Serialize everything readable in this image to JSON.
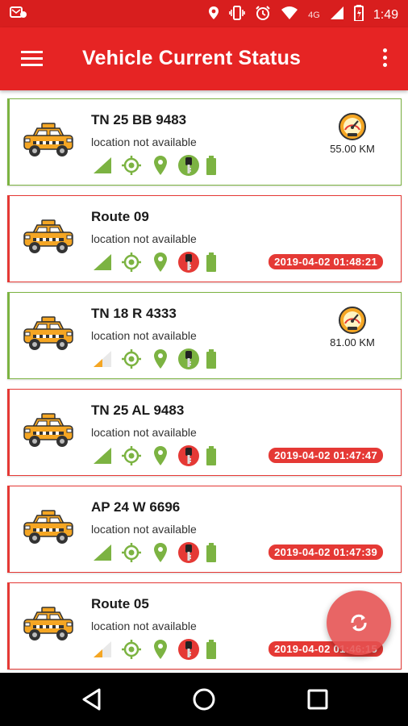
{
  "status_bar": {
    "time": "1:49",
    "network": "4G",
    "icons": [
      "notification-icon",
      "location-icon",
      "vibrate-icon",
      "alarm-icon",
      "wifi-icon",
      "signal-icon",
      "battery-icon"
    ]
  },
  "app_bar": {
    "title": "Vehicle Current Status",
    "menu_icon": "hamburger-menu-icon",
    "overflow_icon": "more-vert-icon"
  },
  "colors": {
    "primary": "#e62424",
    "status_bar": "#d81e1e",
    "online": "#7cb342",
    "offline": "#e53935",
    "taxi": "#f5a623"
  },
  "vehicles": [
    {
      "name": "TN 25 BB 9483",
      "location": "location not available",
      "status": "online",
      "signal": "strong",
      "ignition": "on",
      "speed": "55.00 KM",
      "timestamp": ""
    },
    {
      "name": "Route 09",
      "location": "location not available",
      "status": "offline",
      "signal": "strong",
      "ignition": "off",
      "speed": "",
      "timestamp": "2019-04-02 01:48:21"
    },
    {
      "name": "TN 18 R 4333",
      "location": "location not available",
      "status": "online",
      "signal": "weak",
      "ignition": "on",
      "speed": "81.00 KM",
      "timestamp": ""
    },
    {
      "name": "TN 25 AL 9483",
      "location": "location not available",
      "status": "offline",
      "signal": "strong",
      "ignition": "off",
      "speed": "",
      "timestamp": "2019-04-02 01:47:47"
    },
    {
      "name": "AP 24 W 6696",
      "location": "location not available",
      "status": "offline",
      "signal": "strong",
      "ignition": "off",
      "speed": "",
      "timestamp": "2019-04-02 01:47:39"
    },
    {
      "name": "Route 05",
      "location": "location not available",
      "status": "offline",
      "signal": "weak",
      "ignition": "off",
      "speed": "",
      "timestamp": "2019-04-02 01:46:15"
    }
  ],
  "fab": {
    "icon": "refresh-icon"
  },
  "nav_bar": {
    "icons": [
      "back-icon",
      "home-icon",
      "recents-icon"
    ]
  }
}
